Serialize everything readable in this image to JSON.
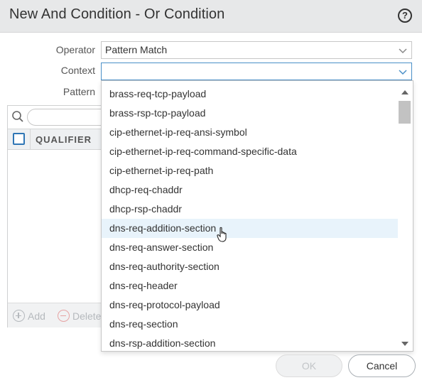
{
  "dialog": {
    "title": "New And Condition - Or Condition",
    "help_icon": "question-circle-icon"
  },
  "form": {
    "operator_label": "Operator",
    "operator_value": "Pattern Match",
    "context_label": "Context",
    "context_value": "",
    "pattern_label": "Pattern"
  },
  "table": {
    "search_placeholder": "",
    "columns": [
      "QUALIFIER"
    ],
    "add_label": "Add",
    "delete_label": "Delete"
  },
  "dropdown": {
    "hovered_index": 7,
    "options": [
      "brass-req-tcp-payload",
      "brass-rsp-tcp-payload",
      "cip-ethernet-ip-req-ansi-symbol",
      "cip-ethernet-ip-req-command-specific-data",
      "cip-ethernet-ip-req-path",
      "dhcp-req-chaddr",
      "dhcp-rsp-chaddr",
      "dns-req-addition-section",
      "dns-req-answer-section",
      "dns-req-authority-section",
      "dns-req-header",
      "dns-req-protocol-payload",
      "dns-req-section",
      "dns-rsp-addition-section"
    ]
  },
  "buttons": {
    "ok_label": "OK",
    "cancel_label": "Cancel"
  },
  "colors": {
    "accent": "#2f76b5",
    "focus_border": "#4a8fc7",
    "hover_bg": "#e8f3fb",
    "titlebar_bg": "#e7e8e9"
  }
}
